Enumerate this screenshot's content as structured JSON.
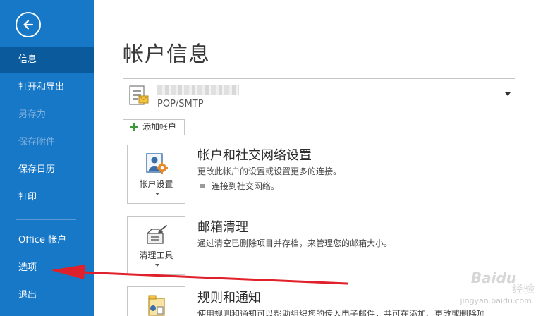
{
  "sidebar": {
    "back_icon": "back-arrow-circle-icon",
    "items": [
      {
        "label": "信息",
        "state": "active"
      },
      {
        "label": "打开和导出",
        "state": "normal"
      },
      {
        "label": "另存为",
        "state": "disabled"
      },
      {
        "label": "保存附件",
        "state": "disabled"
      },
      {
        "label": "保存日历",
        "state": "normal"
      },
      {
        "label": "打印",
        "state": "normal"
      },
      {
        "label": "Office 帐户",
        "state": "normal"
      },
      {
        "label": "选项",
        "state": "normal"
      },
      {
        "label": "退出",
        "state": "normal"
      }
    ],
    "background": "#1878c8",
    "active_background": "#0a5a9c"
  },
  "main": {
    "title": "帐户信息",
    "account_selector": {
      "account_type": "POP/SMTP"
    },
    "add_account_label": "添加帐户",
    "sections": [
      {
        "tile_label": "帐户设置",
        "title": "帐户和社交网络设置",
        "description": "更改此帐户的设置或设置更多的连接。",
        "bullet": "连接到社交网络。"
      },
      {
        "tile_label": "清理工具",
        "title": "邮箱清理",
        "description": "通过清空已删除项目并存档，来管理您的邮箱大小。"
      },
      {
        "tile_label": "",
        "title": "规则和通知",
        "description": "使用规则和通知可以帮助组织您的传入电子邮件，并可在添加、更改或删除项"
      }
    ]
  },
  "overlay": {
    "arrow_color": "#e0202a"
  },
  "watermark": {
    "brand": "Baidu",
    "sub": "经验",
    "url": "jingyan.baidu.com"
  }
}
